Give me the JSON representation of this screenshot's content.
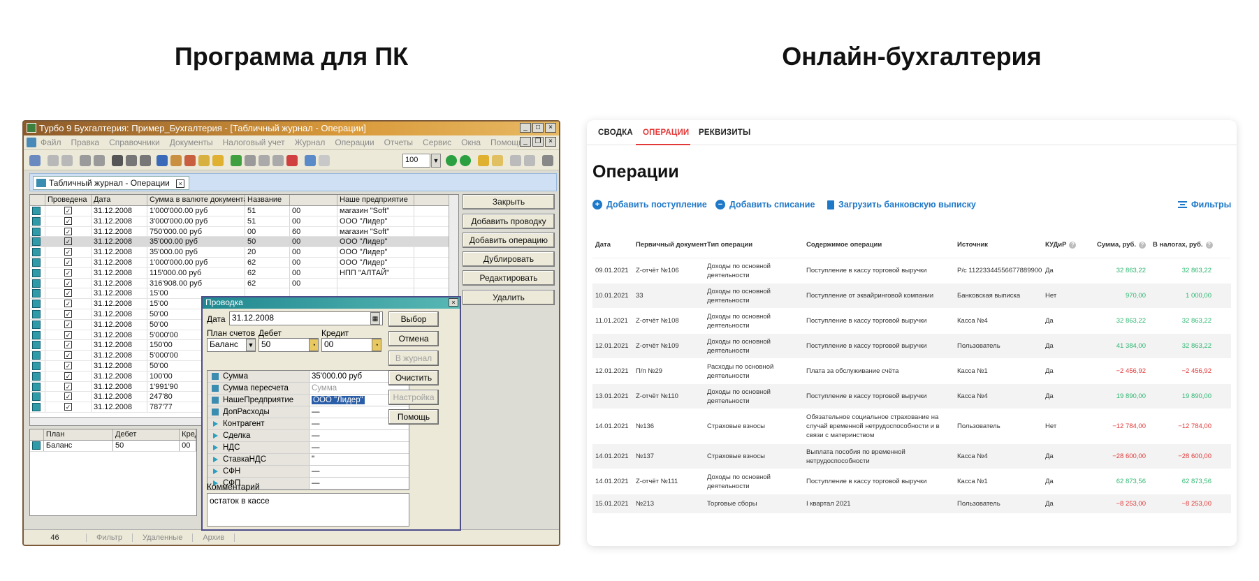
{
  "headings": {
    "left": "Программа для ПК",
    "right": "Онлайн-бухгалтерия"
  },
  "desktop": {
    "window_title": "Турбо 9 Бухгалтерия: Пример_Бухгалтерия - [Табличный журнал - Операции]",
    "menu": [
      "Файл",
      "Правка",
      "Справочники",
      "Документы",
      "Налоговый учет",
      "Журнал",
      "Операции",
      "Отчеты",
      "Сервис",
      "Окна",
      "Помощь"
    ],
    "zoom": "100",
    "doc_tab": "Табличный журнал - Операции",
    "grid_headers": [
      "",
      "Проведена",
      "Дата",
      "Сумма в валюте документа",
      "Название",
      "",
      "Наше предприятие"
    ],
    "grid_rows": [
      {
        "date": "31.12.2008",
        "sum": "1'000'000.00  руб",
        "d": "51",
        "k": "00",
        "org": "магазин \"Soft\""
      },
      {
        "date": "31.12.2008",
        "sum": "3'000'000.00  руб",
        "d": "51",
        "k": "00",
        "org": "ООО \"Лидер\""
      },
      {
        "date": "31.12.2008",
        "sum": "750'000.00  руб",
        "d": "00",
        "k": "60",
        "org": "магазин \"Soft\""
      },
      {
        "date": "31.12.2008",
        "sum": "35'000.00  руб",
        "d": "50",
        "k": "00",
        "org": "ООО \"Лидер\""
      },
      {
        "date": "31.12.2008",
        "sum": "35'000.00  руб",
        "d": "20",
        "k": "00",
        "org": "ООО \"Лидер\""
      },
      {
        "date": "31.12.2008",
        "sum": "1'000'000.00  руб",
        "d": "62",
        "k": "00",
        "org": "ООО \"Лидер\""
      },
      {
        "date": "31.12.2008",
        "sum": "115'000.00  руб",
        "d": "62",
        "k": "00",
        "org": "НПП \"АЛТАЙ\""
      },
      {
        "date": "31.12.2008",
        "sum": "316'908.00  руб",
        "d": "62",
        "k": "00",
        "org": ""
      },
      {
        "date": "31.12.2008",
        "sum": "15'00",
        "d": "",
        "k": "",
        "org": ""
      },
      {
        "date": "31.12.2008",
        "sum": "15'00",
        "d": "",
        "k": "",
        "org": ""
      },
      {
        "date": "31.12.2008",
        "sum": "50'00",
        "d": "",
        "k": "",
        "org": ""
      },
      {
        "date": "31.12.2008",
        "sum": "50'00",
        "d": "",
        "k": "",
        "org": ""
      },
      {
        "date": "31.12.2008",
        "sum": "5'000'00",
        "d": "",
        "k": "",
        "org": ""
      },
      {
        "date": "31.12.2008",
        "sum": "150'00",
        "d": "",
        "k": "",
        "org": ""
      },
      {
        "date": "31.12.2008",
        "sum": "5'000'00",
        "d": "",
        "k": "",
        "org": ""
      },
      {
        "date": "31.12.2008",
        "sum": "50'00",
        "d": "",
        "k": "",
        "org": ""
      },
      {
        "date": "31.12.2008",
        "sum": "100'00",
        "d": "",
        "k": "",
        "org": ""
      },
      {
        "date": "31.12.2008",
        "sum": "1'991'90",
        "d": "",
        "k": "",
        "org": ""
      },
      {
        "date": "31.12.2008",
        "sum": "247'80",
        "d": "",
        "k": "",
        "org": ""
      },
      {
        "date": "31.12.2008",
        "sum": "787'77",
        "d": "",
        "k": "",
        "org": ""
      }
    ],
    "buttons": [
      "Закрыть",
      "Добавить проводку",
      "Добавить операцию",
      "Дублировать",
      "Редактировать",
      "Удалить"
    ],
    "lower_headers": [
      "",
      "План",
      "Дебет",
      "Кред"
    ],
    "lower_row": {
      "plan": "Баланс",
      "debit": "50",
      "credit": "00"
    },
    "status": [
      "46",
      "Фильтр",
      "Удаленные",
      "Архив"
    ],
    "dialog": {
      "title": "Проводка",
      "date_label": "Дата",
      "date_value": "31.12.2008",
      "plan_label": "План счетов",
      "debit_label": "Дебет",
      "credit_label": "Кредит",
      "plan_value": "Баланс",
      "debit_value": "50",
      "credit_value": "00",
      "props": [
        {
          "name": "Сумма",
          "value": "35'000.00 руб",
          "icon": "field-icon"
        },
        {
          "name": "Сумма пересчета",
          "value": "Сумма",
          "icon": "field-icon",
          "gray": true
        },
        {
          "name": "НашеПредприятие",
          "value": "ООО \"Лидер\"",
          "icon": "field-icon",
          "hl": true
        },
        {
          "name": "ДопРасходы",
          "value": "—",
          "icon": "field-icon"
        },
        {
          "name": "Контрагент",
          "value": "—",
          "icon": "arrow-icon"
        },
        {
          "name": "Сделка",
          "value": "—",
          "icon": "arrow-icon"
        },
        {
          "name": "НДС",
          "value": "—",
          "icon": "arrow-icon"
        },
        {
          "name": "СтавкаНДС",
          "value": "\"",
          "icon": "arrow-icon"
        },
        {
          "name": "СФН",
          "value": "—",
          "icon": "arrow-icon"
        },
        {
          "name": "СФП",
          "value": "—",
          "icon": "arrow-icon"
        }
      ],
      "comment_label": "Комментарий",
      "comment_value": "остаток в кассе",
      "buttons": [
        {
          "label": "Выбор",
          "enabled": true
        },
        {
          "label": "Отмена",
          "enabled": true
        },
        {
          "label": "В журнал",
          "enabled": false
        },
        {
          "label": "Очистить",
          "enabled": true
        },
        {
          "label": "Настройка",
          "enabled": false
        },
        {
          "label": "Помощь",
          "enabled": true
        }
      ]
    }
  },
  "online": {
    "tabs": [
      "СВОДКА",
      "ОПЕРАЦИИ",
      "РЕКВИЗИТЫ"
    ],
    "active_tab": "ОПЕРАЦИИ",
    "title": "Операции",
    "actions": [
      "Добавить поступление",
      "Добавить списание",
      "Загрузить банковскую выписку"
    ],
    "filters": "Фильтры",
    "accent": "#e33838",
    "link_color": "#1e78c8",
    "positive_color": "#2eb872",
    "columns": [
      "Дата",
      "Первичный документ",
      "Тип операции",
      "Содержимое операции",
      "Источник",
      "КУДиР",
      "Сумма, руб.",
      "В налогах, руб."
    ],
    "rows": [
      {
        "date": "09.01.2021",
        "doc": "Z-отчёт №106",
        "type": "Доходы по основной деятельности",
        "content": "Поступление в кассу торговой выручки",
        "source": "Р/с 11223344556677889900",
        "kudir": "Да",
        "sum": "32 863,22",
        "tax": "32 863,22",
        "sign": "pos"
      },
      {
        "date": "10.01.2021",
        "doc": "33",
        "type": "Доходы по основной деятельности",
        "content": "Поступление от эквайринговой компании",
        "source": "Банковская выписка",
        "kudir": "Нет",
        "sum": "970,00",
        "tax": "1 000,00",
        "sign": "pos"
      },
      {
        "date": "11.01.2021",
        "doc": "Z-отчёт №108",
        "type": "Доходы по основной деятельности",
        "content": "Поступление в кассу торговой выручки",
        "source": "Касса №4",
        "kudir": "Да",
        "sum": "32 863,22",
        "tax": "32 863,22",
        "sign": "pos"
      },
      {
        "date": "12.01.2021",
        "doc": "Z-отчёт №109",
        "type": "Доходы по основной деятельности",
        "content": "Поступление в кассу торговой выручки",
        "source": "Пользователь",
        "kudir": "Да",
        "sum": "41 384,00",
        "tax": "32 863,22",
        "sign": "pos"
      },
      {
        "date": "12.01.2021",
        "doc": "П/п №29",
        "type": "Расходы по основной деятельности",
        "content": "Плата за обслуживание счёта",
        "source": "Касса №1",
        "kudir": "Да",
        "sum": "−2 456,92",
        "tax": "−2 456,92",
        "sign": "neg"
      },
      {
        "date": "13.01.2021",
        "doc": "Z-отчёт №110",
        "type": "Доходы по основной деятельности",
        "content": "Поступление в кассу торговой выручки",
        "source": "Касса №4",
        "kudir": "Да",
        "sum": "19 890,00",
        "tax": "19 890,00",
        "sign": "pos"
      },
      {
        "date": "14.01.2021",
        "doc": "№136",
        "type": "Страховые взносы",
        "content": "Обязательное социальное страхование на случай временной нетрудоспособности и в связи с материнством",
        "source": "Пользователь",
        "kudir": "Нет",
        "sum": "−12 784,00",
        "tax": "−12 784,00",
        "sign": "neg"
      },
      {
        "date": "14.01.2021",
        "doc": "№137",
        "type": "Страховые взносы",
        "content": "Выплата пособия по временной нетрудоспособности",
        "source": "Касса №4",
        "kudir": "Да",
        "sum": "−28 600,00",
        "tax": "−28 600,00",
        "sign": "neg"
      },
      {
        "date": "14.01.2021",
        "doc": "Z-отчёт №111",
        "type": "Доходы по основной деятельности",
        "content": "Поступление в кассу торговой выручки",
        "source": "Касса №1",
        "kudir": "Да",
        "sum": "62 873,56",
        "tax": "62 873,56",
        "sign": "pos"
      },
      {
        "date": "15.01.2021",
        "doc": "№213",
        "type": "Торговые сборы",
        "content": "I квартал 2021",
        "source": "Пользователь",
        "kudir": "Да",
        "sum": "−8 253,00",
        "tax": "−8 253,00",
        "sign": "neg"
      }
    ]
  }
}
